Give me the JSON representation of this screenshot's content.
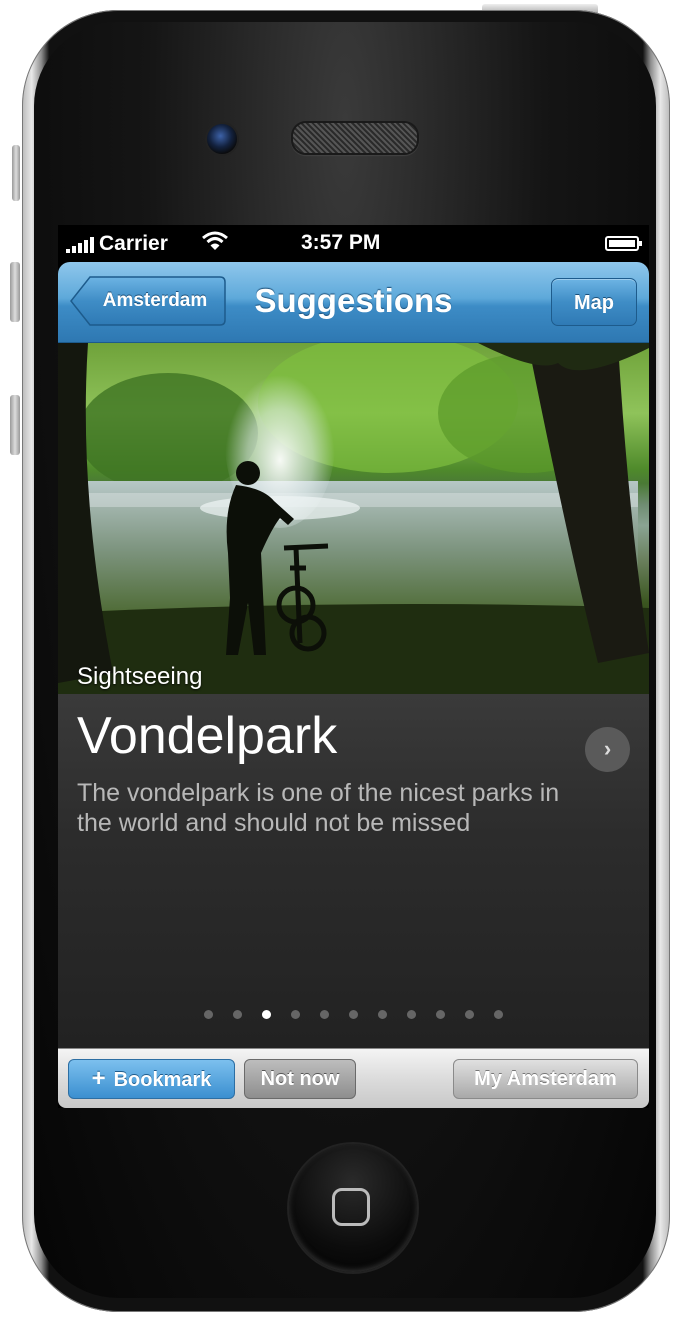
{
  "status_bar": {
    "carrier": "Carrier",
    "time": "3:57 PM",
    "signal_icon": "signal-bars-icon",
    "wifi_icon": "wifi-icon",
    "battery_icon": "battery-icon"
  },
  "nav_bar": {
    "back_label": "Amsterdam",
    "title": "Suggestions",
    "right_button": "Map"
  },
  "suggestion": {
    "category": "Sightseeing",
    "name": "Vondelpark",
    "description": "The vondelpark is one of the nicest parks in the world and should not be missed",
    "detail_icon": "chevron-right-icon"
  },
  "pagination": {
    "total_pages": 11,
    "current_page": 3
  },
  "toolbar": {
    "bookmark_icon": "+",
    "bookmark_label": "Bookmark",
    "not_now_label": "Not now",
    "my_city_label": "My Amsterdam"
  },
  "colors": {
    "nav_blue": "#3d8cc6",
    "bookmark_blue": "#3b8fd0",
    "detail_background": "#2c2c2c"
  }
}
